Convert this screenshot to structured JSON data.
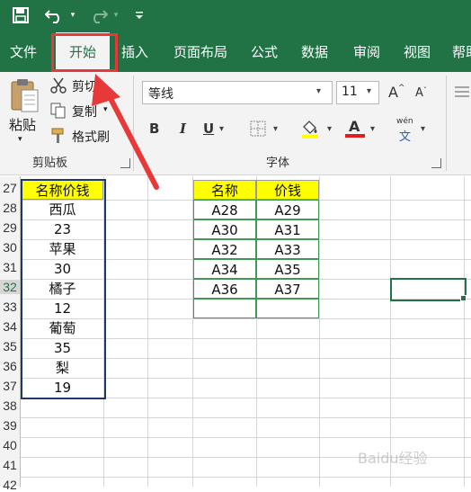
{
  "tabs": [
    "文件",
    "开始",
    "插入",
    "页面布局",
    "公式",
    "数据",
    "审阅",
    "视图",
    "帮助"
  ],
  "clipboard": {
    "paste_label": "粘贴",
    "cut_label": "剪切",
    "copy_label": "复制",
    "format_painter_label": "格式刷",
    "group_label": "剪贴板"
  },
  "font": {
    "font_name": "等线",
    "font_size": "11",
    "bold": "B",
    "italic": "I",
    "underline": "U",
    "font_color_letter": "A",
    "grow_letter": "A",
    "shrink_letter": "A",
    "phonetic_top": "wén",
    "phonetic_bottom": "文",
    "group_label": "字体"
  },
  "row_numbers": [
    "27",
    "28",
    "29",
    "30",
    "31",
    "32",
    "33",
    "34",
    "35",
    "36",
    "37",
    "38",
    "39",
    "40",
    "41",
    "42"
  ],
  "list_table": {
    "header": "名称价钱",
    "values": [
      "西瓜",
      "23",
      "苹果",
      "30",
      "橘子",
      "12",
      "葡萄",
      "35",
      "梨",
      "19"
    ]
  },
  "result_table": {
    "headers": [
      "名称",
      "价钱"
    ],
    "rows": [
      [
        "A28",
        "A29"
      ],
      [
        "A30",
        "A31"
      ],
      [
        "A32",
        "A33"
      ],
      [
        "A34",
        "A35"
      ],
      [
        "A36",
        "A37"
      ],
      [
        "",
        ""
      ]
    ]
  },
  "watermark": "Baidu经验",
  "colors": {
    "excel_green": "#217346",
    "header_yellow": "#ffff00",
    "annotation_red": "#e8393a",
    "table_border_navy": "#1f3864",
    "result_border_green": "#3d9a50"
  }
}
